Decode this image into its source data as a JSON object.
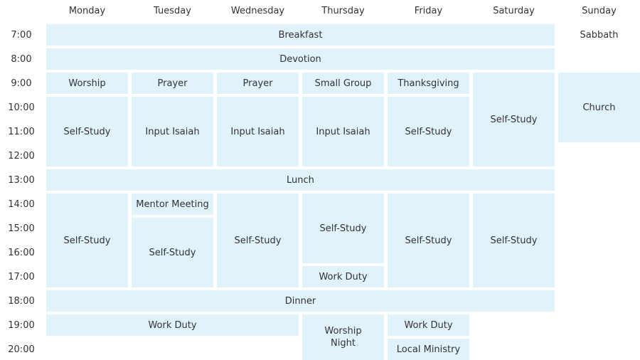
{
  "days": [
    "Monday",
    "Tuesday",
    "Wednesday",
    "Thursday",
    "Friday",
    "Saturday",
    "Sunday"
  ],
  "times": [
    "7:00",
    "8:00",
    "9:00",
    "10:00",
    "11:00",
    "12:00",
    "13:00",
    "14:00",
    "15:00",
    "16:00",
    "17:00",
    "18:00",
    "19:00",
    "20:00"
  ],
  "events": [
    {
      "label": "Breakfast",
      "col": 0,
      "span": 6,
      "row": 0,
      "rows": 1
    },
    {
      "label": "Devotion",
      "col": 0,
      "span": 6,
      "row": 1,
      "rows": 1
    },
    {
      "label": "Worship",
      "col": 0,
      "span": 1,
      "row": 2,
      "rows": 1
    },
    {
      "label": "Prayer",
      "col": 1,
      "span": 1,
      "row": 2,
      "rows": 1
    },
    {
      "label": "Prayer",
      "col": 2,
      "span": 1,
      "row": 2,
      "rows": 1
    },
    {
      "label": "Small Group",
      "col": 3,
      "span": 1,
      "row": 2,
      "rows": 1
    },
    {
      "label": "Thanksgiving",
      "col": 4,
      "span": 1,
      "row": 2,
      "rows": 1
    },
    {
      "label": "Self-Study",
      "col": 5,
      "span": 1,
      "row": 2,
      "rows": 4
    },
    {
      "label": "Church",
      "col": 6,
      "span": 1,
      "row": 2,
      "rows": 3
    },
    {
      "label": "Self-Study",
      "col": 0,
      "span": 1,
      "row": 3,
      "rows": 3
    },
    {
      "label": "Input Isaiah",
      "col": 1,
      "span": 1,
      "row": 3,
      "rows": 3
    },
    {
      "label": "Input Isaiah",
      "col": 2,
      "span": 1,
      "row": 3,
      "rows": 3
    },
    {
      "label": "Input Isaiah",
      "col": 3,
      "span": 1,
      "row": 3,
      "rows": 3
    },
    {
      "label": "Self-Study",
      "col": 4,
      "span": 1,
      "row": 3,
      "rows": 3
    },
    {
      "label": "Lunch",
      "col": 0,
      "span": 6,
      "row": 6,
      "rows": 1
    },
    {
      "label": "Self-Study",
      "col": 0,
      "span": 1,
      "row": 7,
      "rows": 4
    },
    {
      "label": "Mentor Meeting",
      "col": 1,
      "span": 1,
      "row": 7,
      "rows": 1
    },
    {
      "label": "Self-Study",
      "col": 1,
      "span": 1,
      "row": 8,
      "rows": 3
    },
    {
      "label": "Self-Study",
      "col": 2,
      "span": 1,
      "row": 7,
      "rows": 4
    },
    {
      "label": "Self-Study",
      "col": 3,
      "span": 1,
      "row": 7,
      "rows": 3
    },
    {
      "label": "Work Duty",
      "col": 3,
      "span": 1,
      "row": 10,
      "rows": 1
    },
    {
      "label": "Self-Study",
      "col": 4,
      "span": 1,
      "row": 7,
      "rows": 4
    },
    {
      "label": "Self-Study",
      "col": 5,
      "span": 1,
      "row": 7,
      "rows": 4
    },
    {
      "label": "Dinner",
      "col": 0,
      "span": 6,
      "row": 11,
      "rows": 1
    },
    {
      "label": "Work Duty",
      "col": 0,
      "span": 3,
      "row": 12,
      "rows": 1
    },
    {
      "label": "Worship Night",
      "col": 3,
      "span": 1,
      "row": 12,
      "rows": 2
    },
    {
      "label": "Work Duty",
      "col": 4,
      "span": 1,
      "row": 12,
      "rows": 1
    },
    {
      "label": "Local Ministry",
      "col": 4,
      "span": 1,
      "row": 13,
      "rows": 1
    }
  ],
  "plain_events": [
    {
      "label": "Sabbath",
      "col": 6,
      "row": 0
    }
  ]
}
